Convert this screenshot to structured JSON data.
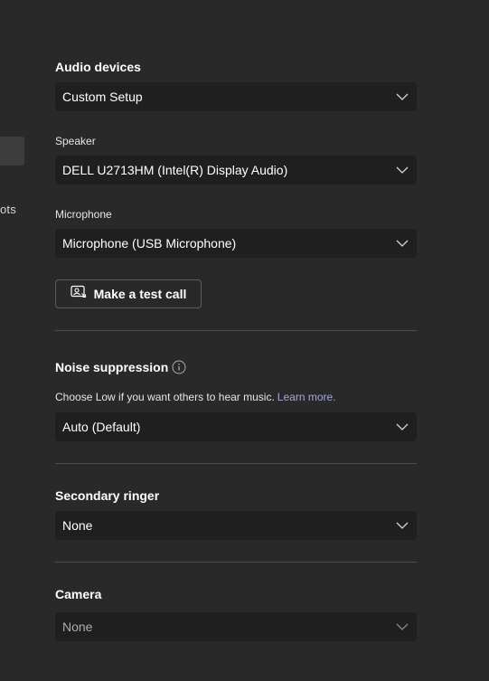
{
  "nav": {
    "partial_label": "ots"
  },
  "audio_devices": {
    "heading": "Audio devices",
    "value": "Custom Setup"
  },
  "speaker": {
    "label": "Speaker",
    "value": "DELL U2713HM (Intel(R) Display Audio)"
  },
  "microphone": {
    "label": "Microphone",
    "value": "Microphone (USB Microphone)"
  },
  "test_call": {
    "label": "Make a test call",
    "icon": "test-call-icon"
  },
  "noise_suppression": {
    "heading": "Noise suppression",
    "icon": "info-icon",
    "description": "Choose Low if you want others to hear music.",
    "link": "Learn more.",
    "value": "Auto (Default)"
  },
  "secondary_ringer": {
    "heading": "Secondary ringer",
    "value": "None"
  },
  "camera": {
    "heading": "Camera",
    "value": "None"
  },
  "colors": {
    "background": "#292929",
    "select_bg": "#1f1f1f",
    "link": "#a6a7dc",
    "divider": "#4d4d4d"
  }
}
